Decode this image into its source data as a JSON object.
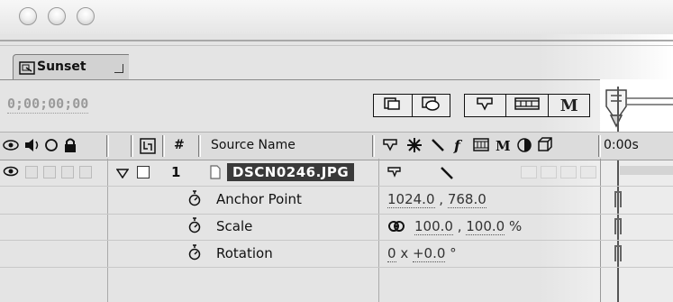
{
  "window": {
    "traffic_lights": [
      "close",
      "minimize",
      "zoom"
    ]
  },
  "tab": {
    "label": "Sunset",
    "icon": "composition-icon"
  },
  "toolbar": {
    "timecode": "0;00;00;00",
    "mode_button": "M"
  },
  "header": {
    "av_icons": [
      "eye-icon",
      "speaker-icon",
      "solo-icon",
      "lock-icon"
    ],
    "parent_icon": "parent-icon",
    "number_label": "#",
    "source_name_label": "Source Name",
    "switch_icons": [
      "shy-icon",
      "collapse-icon",
      "quality-icon",
      "effect-icon",
      "frame-blend-icon",
      "motion-blur-icon",
      "adjustment-icon",
      "3d-icon"
    ],
    "time_label": "0:00s"
  },
  "layer": {
    "number": "1",
    "name": "DSCN0246.JPG",
    "properties": [
      {
        "name": "Anchor Point",
        "value1": "1024.0",
        "sep": " , ",
        "value2": "768.0",
        "suffix": ""
      },
      {
        "name": "Scale",
        "value1": "100.0",
        "sep": " , ",
        "value2": "100.0",
        "suffix": " %"
      },
      {
        "name": "Rotation",
        "value1": "0",
        "sep": " x ",
        "value2": "+0.0",
        "suffix": " °"
      }
    ]
  }
}
